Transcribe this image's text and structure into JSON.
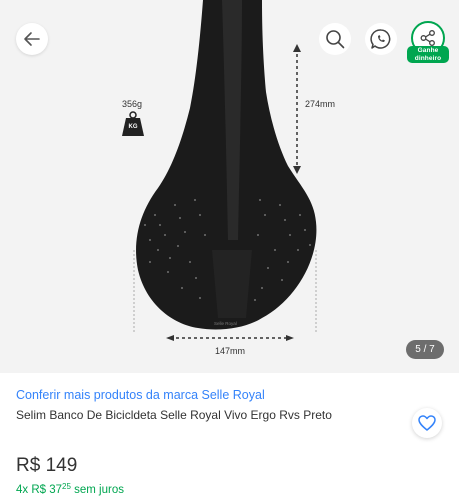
{
  "gallery": {
    "weight_label": "356g",
    "kg_label": "KG",
    "length_label": "274mm",
    "width_label": "147mm",
    "image_counter": "5 / 7"
  },
  "header": {
    "share_badge_line1": "Ganhe",
    "share_badge_line2": "dinheiro"
  },
  "product": {
    "brand_link": "Conferir mais produtos da marca Selle Royal",
    "title": "Selim Banco De Bicicldeta Selle Royal Vivo Ergo Rvs Preto",
    "price": "R$ 149",
    "installments_prefix": "4x R$ 37",
    "installments_cents": "25",
    "installments_suffix": " sem juros"
  },
  "colors": {
    "link": "#3483fa",
    "success": "#00a650",
    "gallery_bg": "#f3f3f3"
  }
}
